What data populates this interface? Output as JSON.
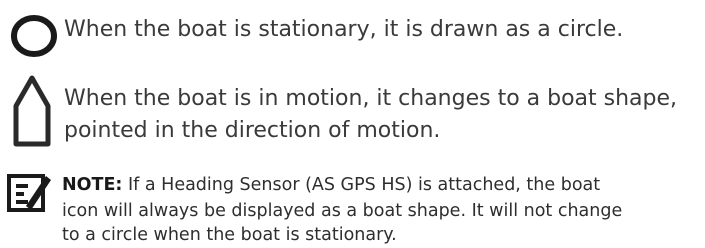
{
  "rows": [
    {
      "icon": "circle-boat-icon",
      "text": "When the boat is stationary, it is drawn as a circle."
    },
    {
      "icon": "boat-shape-icon",
      "lines": [
        "When the boat is in motion, it changes to a boat shape,",
        "pointed in the direction of motion."
      ]
    }
  ],
  "note": {
    "icon": "note-pencil-icon",
    "label": "NOTE:",
    "lines": [
      " If a Heading Sensor (AS GPS HS) is attached, the boat",
      "icon will always be displayed as a boat shape. It will not change",
      "to a circle when the boat is stationary."
    ]
  }
}
